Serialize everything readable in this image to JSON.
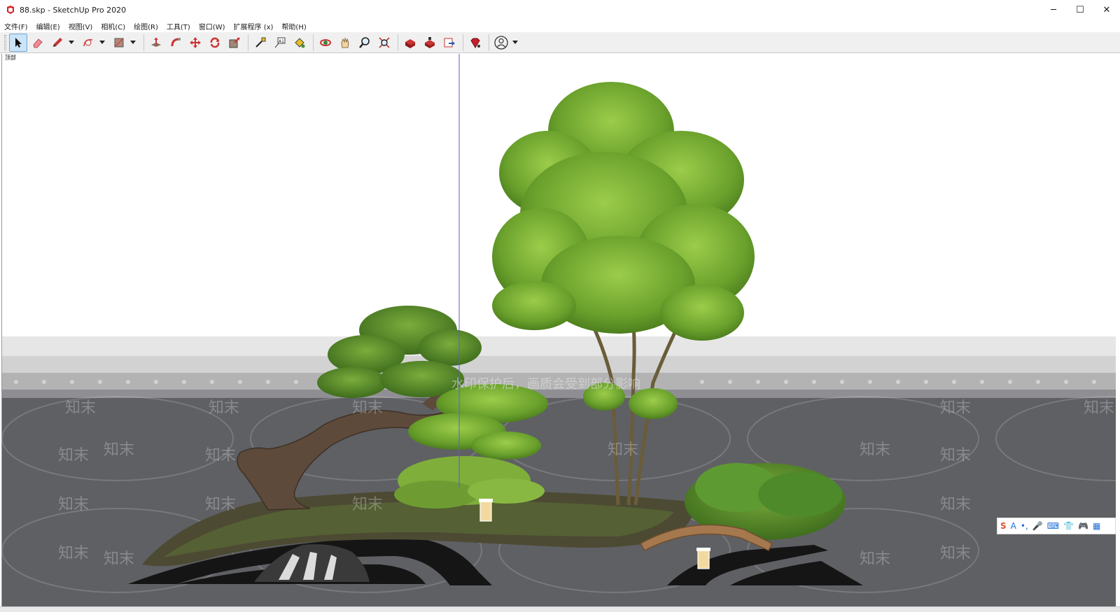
{
  "window": {
    "title": "88.skp - SketchUp Pro 2020",
    "controls": {
      "minimize": "─",
      "maximize": "☐",
      "close": "✕"
    }
  },
  "menu": {
    "items": [
      "文件(F)",
      "编辑(E)",
      "视图(V)",
      "相机(C)",
      "绘图(R)",
      "工具(T)",
      "窗口(W)",
      "扩展程序 (x)",
      "帮助(H)"
    ]
  },
  "toolbar": {
    "tools": [
      "select-icon",
      "eraser-icon",
      "pencil-icon",
      "arc-icon",
      "rectangle-icon",
      "push-pull-icon",
      "follow-me-icon",
      "move-icon",
      "rotate-icon",
      "scale-icon",
      "tape-measure-icon",
      "text-icon",
      "paint-bucket-icon",
      "orbit-icon",
      "pan-icon",
      "zoom-icon",
      "zoom-extents-icon",
      "3d-warehouse-icon",
      "extension-warehouse-icon",
      "send-to-layout-icon",
      "ruby-icon",
      "account-icon"
    ]
  },
  "viewport": {
    "scene_label": "顶部",
    "watermark_brand": "知末",
    "watermark_notice": "水印保护后，画质会受到部分影响"
  },
  "ime": {
    "items": [
      "S",
      "A",
      "•,",
      "🎤",
      "⌨",
      "👕",
      "🎮",
      "▦"
    ]
  },
  "colors": {
    "toolbar_bg": "#f0f0f0",
    "ground": "#5f6064",
    "foliage": "#6aa12c",
    "accent": "#cce4f7"
  }
}
